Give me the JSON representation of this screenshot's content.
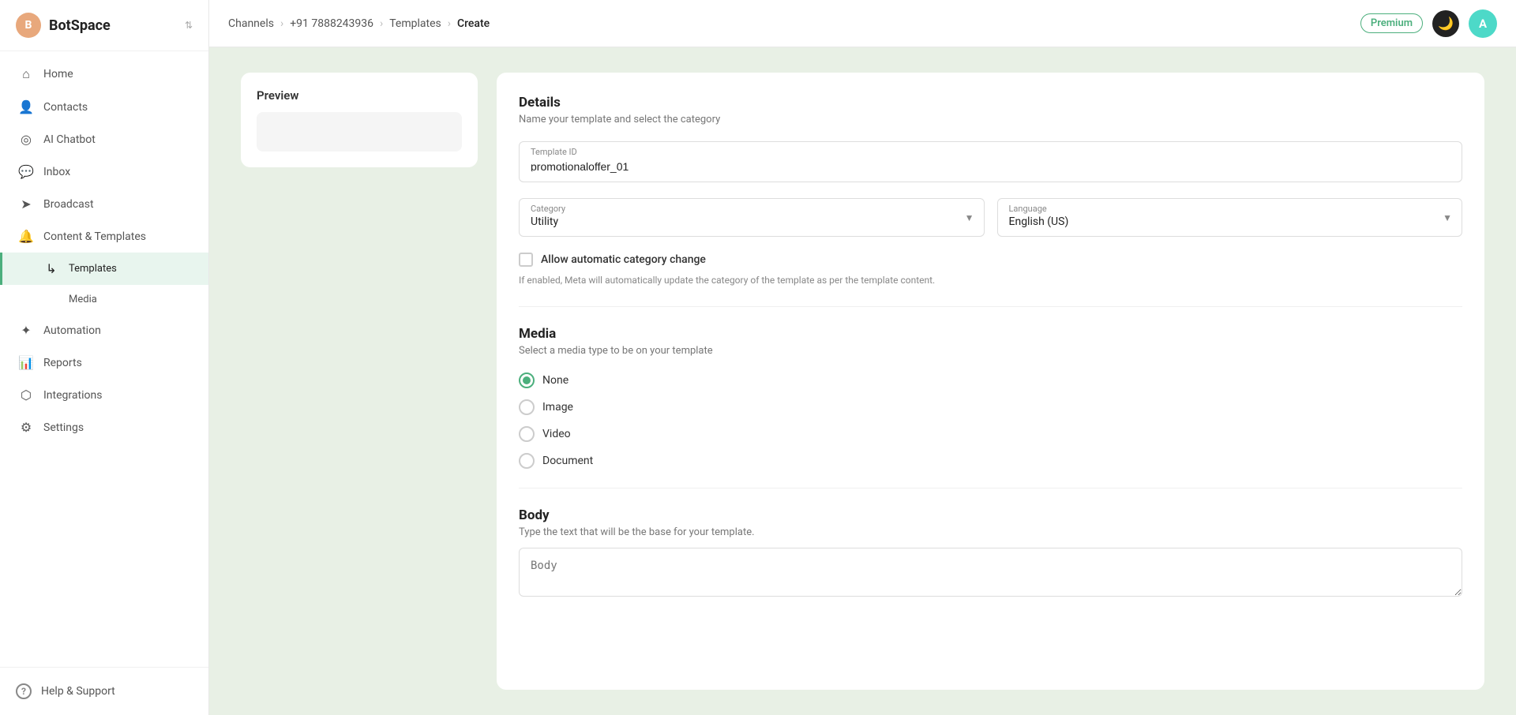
{
  "app": {
    "name": "BotSpace",
    "logo_initial": "B"
  },
  "header": {
    "breadcrumb": {
      "channels": "Channels",
      "phone": "+91 7888243936",
      "templates": "Templates",
      "create": "Create"
    },
    "premium_label": "Premium",
    "theme_icon": "🌙",
    "user_initial": "A"
  },
  "sidebar": {
    "nav_items": [
      {
        "id": "home",
        "label": "Home",
        "icon": "⌂"
      },
      {
        "id": "contacts",
        "label": "Contacts",
        "icon": "👤"
      },
      {
        "id": "ai-chatbot",
        "label": "AI Chatbot",
        "icon": "◎"
      },
      {
        "id": "inbox",
        "label": "Inbox",
        "icon": "💬"
      },
      {
        "id": "broadcast",
        "label": "Broadcast",
        "icon": "➤"
      },
      {
        "id": "content-templates",
        "label": "Content & Templates",
        "icon": "🔔"
      },
      {
        "id": "templates",
        "label": "Templates",
        "icon": "↳",
        "sub": true
      },
      {
        "id": "media",
        "label": "Media",
        "icon": "",
        "sub": true
      },
      {
        "id": "automation",
        "label": "Automation",
        "icon": "✦"
      },
      {
        "id": "reports",
        "label": "Reports",
        "icon": "📊"
      },
      {
        "id": "integrations",
        "label": "Integrations",
        "icon": "⬡"
      },
      {
        "id": "settings",
        "label": "Settings",
        "icon": "⚙"
      }
    ],
    "help_label": "Help & Support",
    "help_icon": "?"
  },
  "preview": {
    "title": "Preview"
  },
  "details": {
    "title": "Details",
    "subtitle": "Name your template and select the category",
    "template_id_label": "Template ID",
    "template_id_value": "promotionaloffer_01",
    "category_label": "Category",
    "category_value": "Utility",
    "language_label": "Language",
    "language_value": "English (US)",
    "auto_category_label": "Allow automatic category change",
    "auto_category_desc": "If enabled, Meta will automatically update the category of the template as per the template content.",
    "media_title": "Media",
    "media_subtitle": "Select a media type to be on your template",
    "media_options": [
      {
        "id": "none",
        "label": "None",
        "selected": true
      },
      {
        "id": "image",
        "label": "Image",
        "selected": false
      },
      {
        "id": "video",
        "label": "Video",
        "selected": false
      },
      {
        "id": "document",
        "label": "Document",
        "selected": false
      }
    ],
    "body_title": "Body",
    "body_subtitle": "Type the text that will be the base for your template.",
    "body_placeholder": "Body"
  }
}
